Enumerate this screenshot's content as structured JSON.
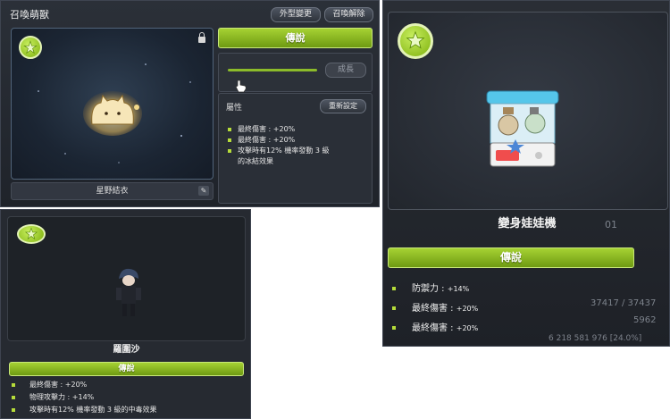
{
  "panel1": {
    "title": "召喚萌獸",
    "buttons": {
      "appearance": "外型變更",
      "dismiss": "召喚解除"
    },
    "pet_name": "星野結衣",
    "grade": "傳說",
    "growth_button": "成長",
    "attributes": {
      "title": "屬性",
      "reset_button": "重新設定",
      "stats": [
        "最終傷害 : +20%",
        "最終傷害 : +20%",
        "攻擊時有12% 機率發動 3 級的冰結效果"
      ]
    }
  },
  "panel2": {
    "pet_name": "變身娃娃機",
    "grade": "傳說",
    "stats": [
      {
        "label": "防禦力 :",
        "value": "+14%"
      },
      {
        "label": "最終傷害 :",
        "value": "+20%"
      },
      {
        "label": "最終傷害 :",
        "value": "+20%"
      }
    ],
    "background_text": {
      "page": "01",
      "hp": "37417 / 37437",
      "mp": "5962",
      "exp": "6 218 581 976 [24.0%]"
    }
  },
  "panel3": {
    "pet_name": "羅圍沙",
    "grade": "傳說",
    "stats": [
      "最終傷害 : +20%",
      "物理攻擊力 : +14%",
      "攻擊時有12% 機率發動 3 級的中毒效果"
    ]
  },
  "colors": {
    "grade_green": "#8cbb2a",
    "panel_bg": "#262a31"
  }
}
